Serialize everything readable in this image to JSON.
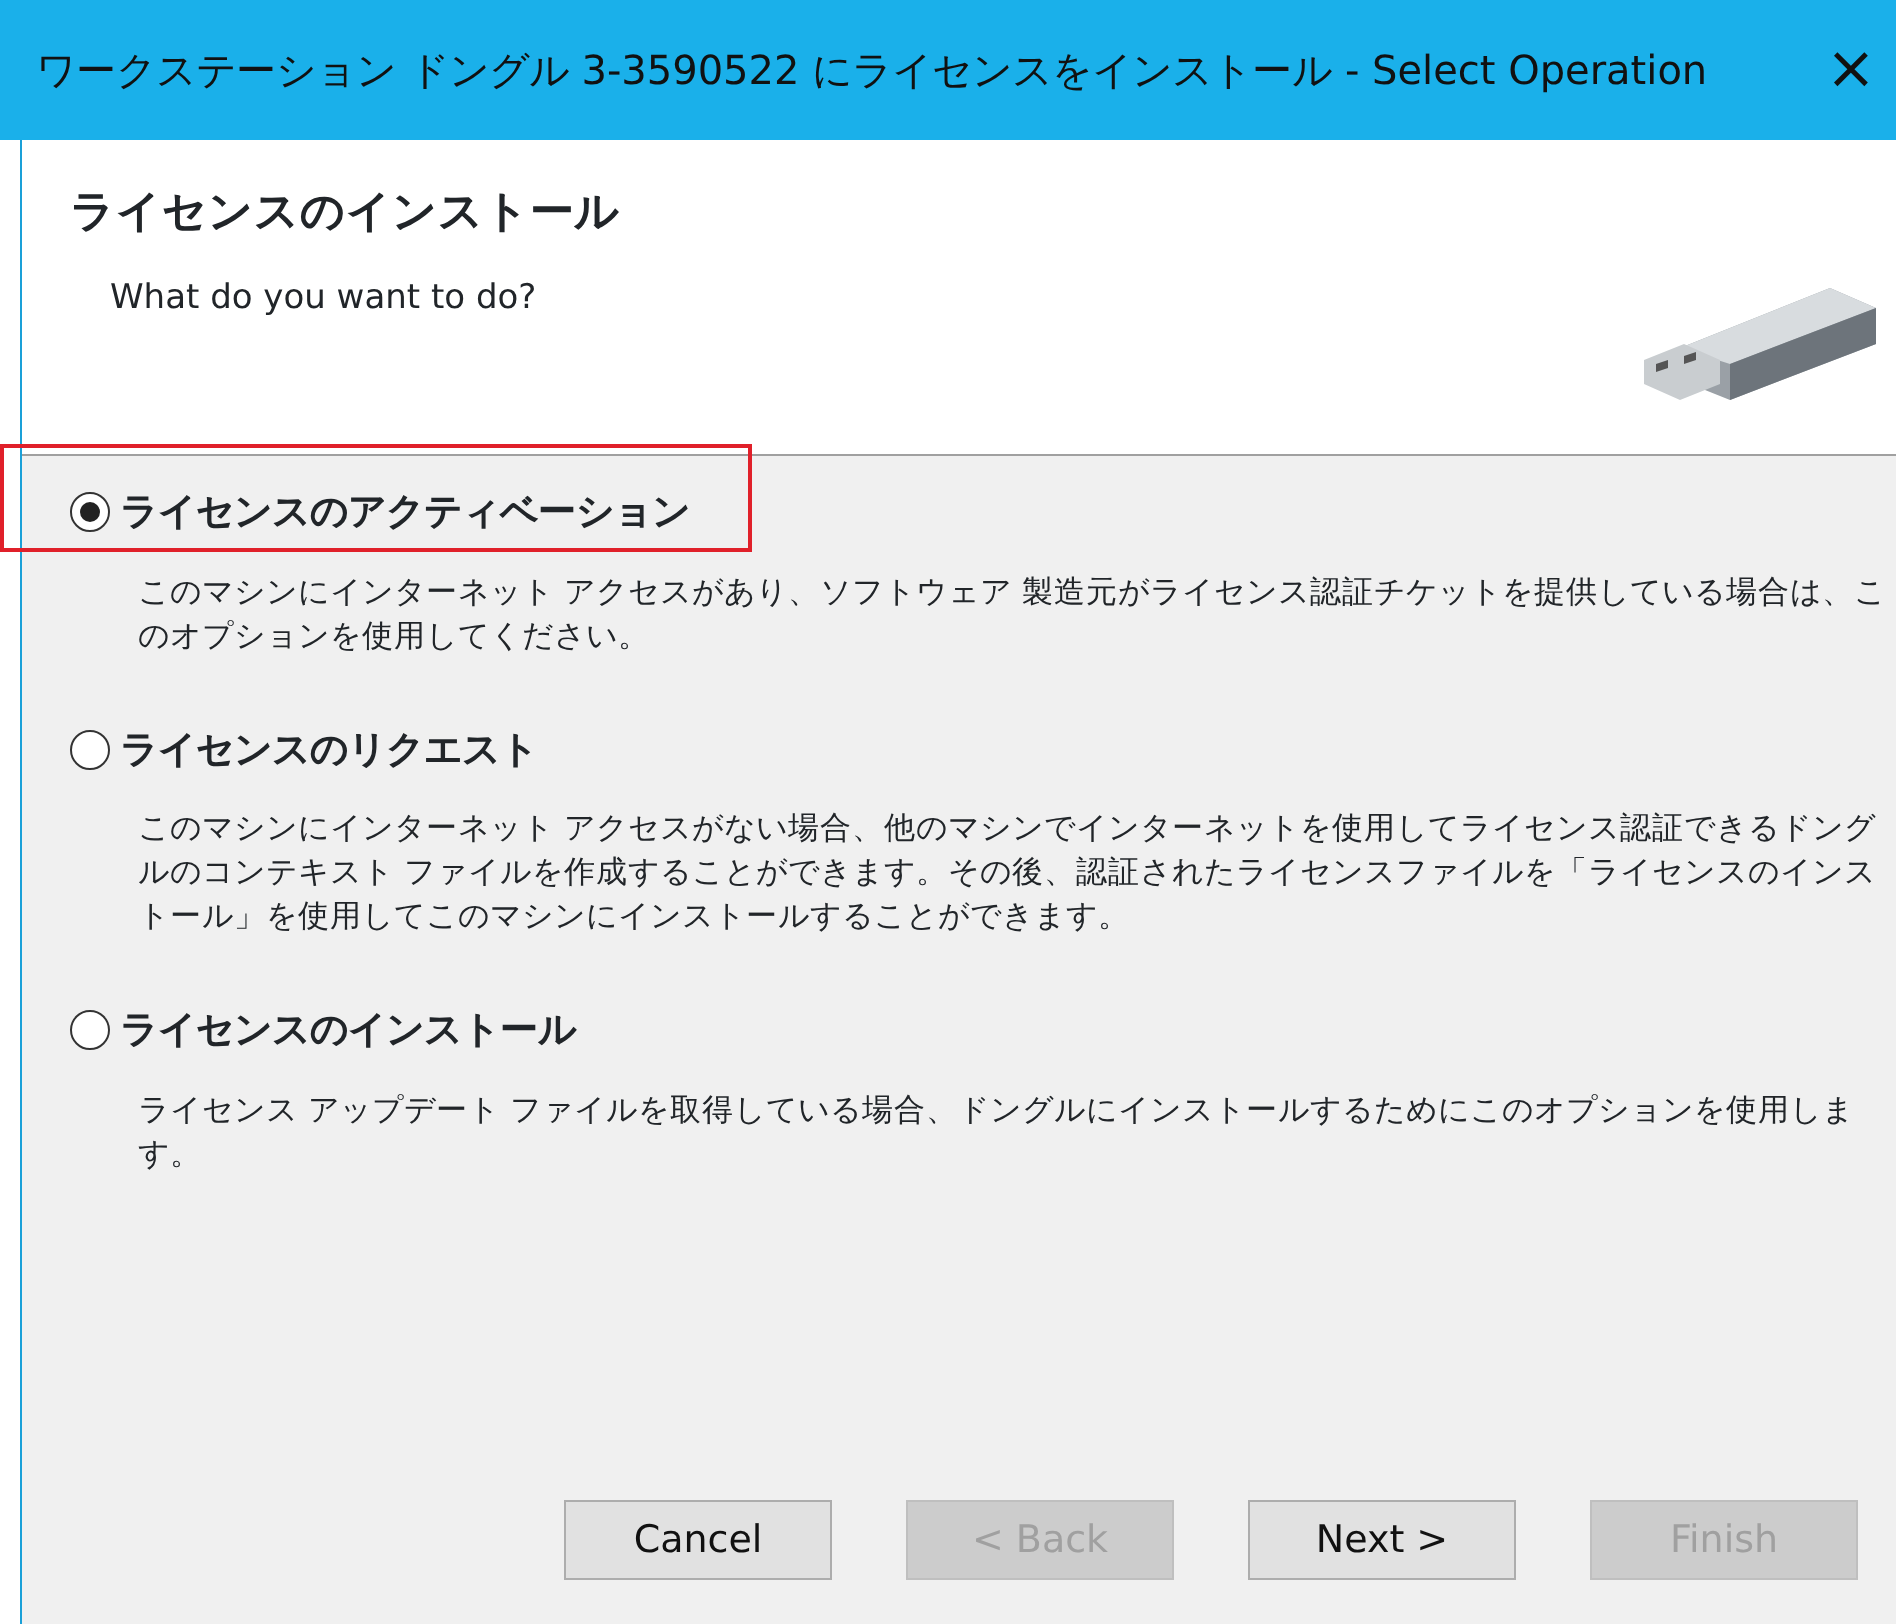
{
  "window": {
    "title": "ワークステーション ドングル 3-3590522 にライセンスをインストール - Select Operation",
    "close": "×"
  },
  "header": {
    "title": "ライセンスのインストール",
    "subtitle": "What do you want to do?"
  },
  "options": [
    {
      "label": "ライセンスのアクティベーション",
      "selected": true,
      "highlighted": true,
      "description": "このマシンにインターネット アクセスがあり、ソフトウェア 製造元がライセンス認証チケットを提供している場合は、このオプションを使用してください。"
    },
    {
      "label": "ライセンスのリクエスト",
      "selected": false,
      "highlighted": false,
      "description": "このマシンにインターネット アクセスがない場合、他のマシンでインターネットを使用してライセンス認証できるドングルのコンテキスト ファイルを作成することができます。その後、認証されたライセンスファイルを「ライセンスのインストール」を使用してこのマシンにインストールすることができます。"
    },
    {
      "label": "ライセンスのインストール",
      "selected": false,
      "highlighted": false,
      "description": "ライセンス アップデート ファイルを取得している場合、ドングルにインストールするためにこのオプションを使用します。"
    }
  ],
  "buttons": [
    {
      "label": "Cancel",
      "disabled": false
    },
    {
      "label": "< Back",
      "disabled": true
    },
    {
      "label": "Next >",
      "disabled": false
    },
    {
      "label": "Finish",
      "disabled": true
    }
  ]
}
